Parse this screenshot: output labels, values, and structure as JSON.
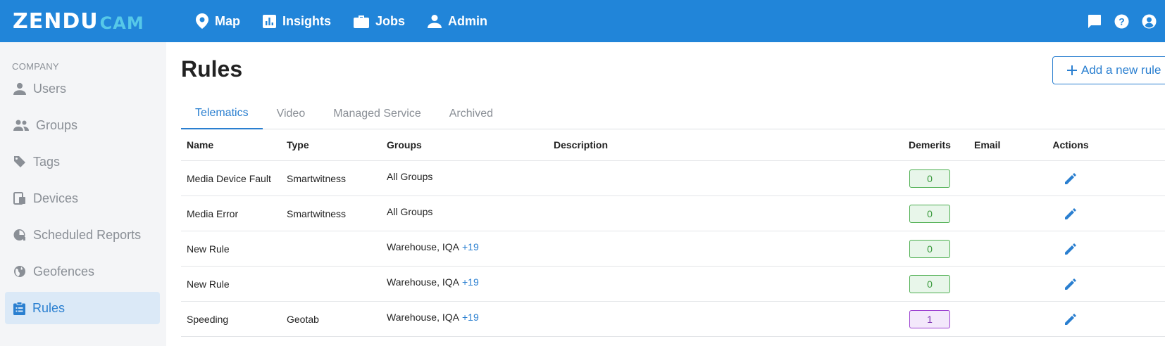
{
  "brand": {
    "logo_main": "ZENDU",
    "logo_sub": "CAM"
  },
  "nav": [
    {
      "label": "Map",
      "icon": "map-pin-icon"
    },
    {
      "label": "Insights",
      "icon": "bar-chart-icon"
    },
    {
      "label": "Jobs",
      "icon": "briefcase-icon"
    },
    {
      "label": "Admin",
      "icon": "person-icon"
    }
  ],
  "top_icons": [
    "chat-icon",
    "help-icon",
    "account-icon"
  ],
  "sidebar": {
    "heading": "COMPANY",
    "items": [
      {
        "label": "Users",
        "icon": "person-icon"
      },
      {
        "label": "Groups",
        "icon": "people-icon"
      },
      {
        "label": "Tags",
        "icon": "tag-icon"
      },
      {
        "label": "Devices",
        "icon": "devices-icon"
      },
      {
        "label": "Scheduled Reports",
        "icon": "clock-pie-icon"
      },
      {
        "label": "Geofences",
        "icon": "globe-icon"
      },
      {
        "label": "Rules",
        "icon": "clipboard-icon",
        "active": true
      }
    ]
  },
  "page": {
    "title": "Rules",
    "add_button": "Add a new rule"
  },
  "tabs": [
    {
      "label": "Telematics",
      "active": true
    },
    {
      "label": "Video"
    },
    {
      "label": "Managed Service"
    },
    {
      "label": "Archived"
    }
  ],
  "table": {
    "columns": {
      "name": "Name",
      "type": "Type",
      "groups": "Groups",
      "description": "Description",
      "demerits": "Demerits",
      "email": "Email",
      "actions": "Actions"
    },
    "rows": [
      {
        "name": "Media Device Fault",
        "type": "Smartwitness",
        "groups": "All Groups",
        "more": "",
        "description": "",
        "demerits": "0",
        "demerit_color": "green",
        "email": ""
      },
      {
        "name": "Media Error",
        "type": "Smartwitness",
        "groups": "All Groups",
        "more": "",
        "description": "",
        "demerits": "0",
        "demerit_color": "green",
        "email": ""
      },
      {
        "name": "New Rule",
        "type": "",
        "groups": "Warehouse, IQA",
        "more": "+19",
        "description": "",
        "demerits": "0",
        "demerit_color": "green",
        "email": ""
      },
      {
        "name": "New Rule",
        "type": "",
        "groups": "Warehouse, IQA",
        "more": "+19",
        "description": "",
        "demerits": "0",
        "demerit_color": "green",
        "email": ""
      },
      {
        "name": "Speeding",
        "type": "Geotab",
        "groups": "Warehouse, IQA",
        "more": "+19",
        "description": "",
        "demerits": "1",
        "demerit_color": "purple",
        "email": ""
      }
    ]
  },
  "colors": {
    "primary": "#2185d9",
    "accent": "#2a7fd0",
    "badge_green": "#4cae4f",
    "badge_purple": "#9b3fd0"
  }
}
